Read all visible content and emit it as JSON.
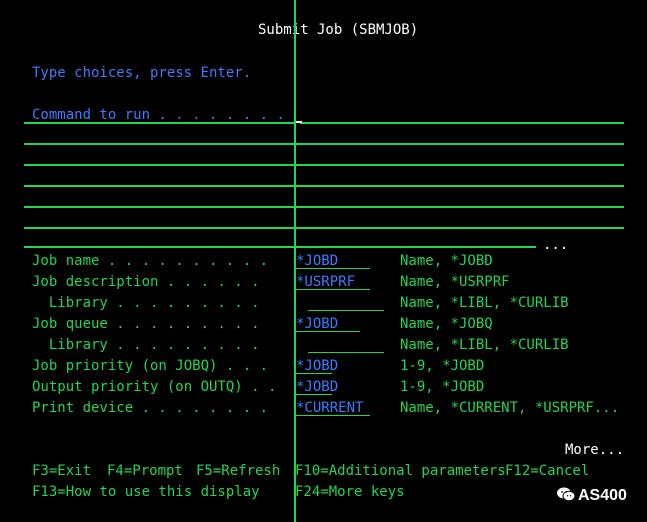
{
  "screen": {
    "title": "Submit Job (SBMJOB)",
    "instruction": "Type choices, press Enter.",
    "command_label": "Command to run . . . . . . . .",
    "command_ellipsis": "...",
    "more": "More..."
  },
  "params": [
    {
      "label": "Job name . . . . . . . . . .",
      "value": "*JOBD",
      "info": "Name, *JOBD"
    },
    {
      "label": "Job description . . . . . .",
      "value": "*USRPRF",
      "info": "Name, *USRPRF"
    },
    {
      "label": "  Library . . . . . . . . .",
      "value": "",
      "info": "Name, *LIBL, *CURLIB"
    },
    {
      "label": "Job queue . . . . . . . . .",
      "value": "*JOBD",
      "info": "Name, *JOBQ"
    },
    {
      "label": "  Library . . . . . . . . .",
      "value": "",
      "info": "Name, *LIBL, *CURLIB"
    },
    {
      "label": "Job priority (on JOBQ) . . .",
      "value": "*JOBD",
      "info": "1-9, *JOBD"
    },
    {
      "label": "Output priority (on OUTQ) . .",
      "value": "*JOBD",
      "info": "1-9, *JOBD"
    },
    {
      "label": "Print device . . . . . . . .",
      "value": "*CURRENT",
      "info": "Name, *CURRENT, *USRPRF..."
    }
  ],
  "fkeys": {
    "f3": "F3=Exit",
    "f4": "F4=Prompt",
    "f5": "F5=Refresh",
    "f10": "F10=Additional parameters",
    "f12": "F12=Cancel",
    "f13": "F13=How to use this display",
    "f24": "F24=More keys"
  },
  "watermark": {
    "text": "AS400",
    "icon": "wechat-icon"
  },
  "colors": {
    "background": "#000000",
    "green": "#25d54d",
    "blue": "#3d7cff",
    "white": "#ffffff"
  }
}
